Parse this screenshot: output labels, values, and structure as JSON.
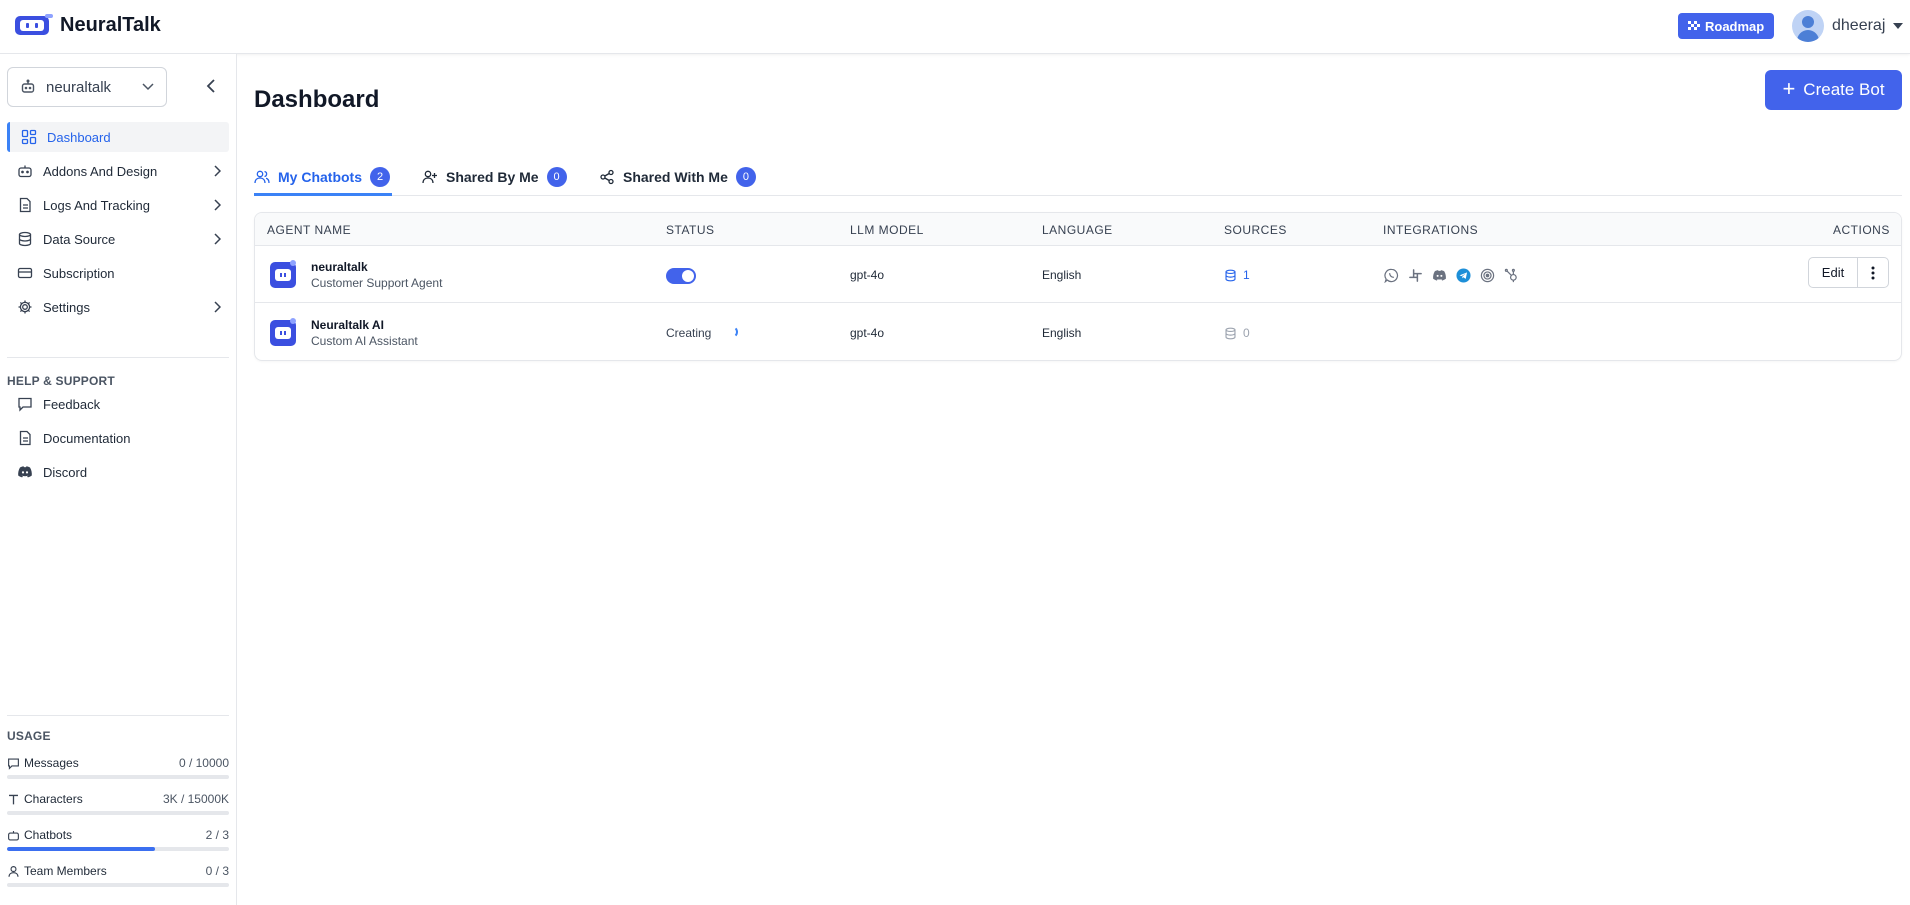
{
  "app": {
    "name": "NeuralTalk"
  },
  "header": {
    "roadmap_label": "Roadmap",
    "user_name": "dheeraj"
  },
  "sidebar": {
    "bot_selector": "neuraltalk",
    "items": [
      {
        "label": "Dashboard",
        "icon": "dashboard-icon",
        "active": true
      },
      {
        "label": "Addons And Design",
        "icon": "bot-icon"
      },
      {
        "label": "Logs And Tracking",
        "icon": "document-icon"
      },
      {
        "label": "Data Source",
        "icon": "database-icon"
      },
      {
        "label": "Subscription",
        "icon": "card-icon"
      },
      {
        "label": "Settings",
        "icon": "gear-icon"
      }
    ],
    "help_title": "HELP & SUPPORT",
    "help_items": [
      {
        "label": "Feedback",
        "icon": "chat-icon"
      },
      {
        "label": "Documentation",
        "icon": "document-icon"
      },
      {
        "label": "Discord",
        "icon": "discord-icon"
      }
    ],
    "usage_title": "USAGE",
    "usage": [
      {
        "label": "Messages",
        "value": "0 / 10000",
        "fraction": 0.0
      },
      {
        "label": "Characters",
        "value": "3K / 15000K",
        "fraction": 0.0002
      },
      {
        "label": "Chatbots",
        "value": "2 / 3",
        "fraction": 0.667
      },
      {
        "label": "Team Members",
        "value": "0 / 3",
        "fraction": 0.0
      }
    ]
  },
  "main": {
    "title": "Dashboard",
    "create_label": "Create Bot",
    "tabs": [
      {
        "label": "My Chatbots",
        "count": "2"
      },
      {
        "label": "Shared By Me",
        "count": "0"
      },
      {
        "label": "Shared With Me",
        "count": "0"
      }
    ],
    "table": {
      "headers": [
        "AGENT NAME",
        "STATUS",
        "LLM MODEL",
        "LANGUAGE",
        "SOURCES",
        "INTEGRATIONS",
        "ACTIONS"
      ],
      "rows": [
        {
          "name": "neuraltalk",
          "subtitle": "Customer Support Agent",
          "status": "",
          "model": "gpt-4o",
          "language": "English",
          "sources": "1"
        },
        {
          "name": "Neuraltalk AI",
          "subtitle": "Custom AI Assistant",
          "status": "Creating",
          "model": "gpt-4o",
          "language": "English",
          "sources": "0"
        }
      ],
      "edit_label": "Edit"
    }
  },
  "colors": {
    "accent": "#4263eb",
    "active_text": "#2563eb"
  }
}
